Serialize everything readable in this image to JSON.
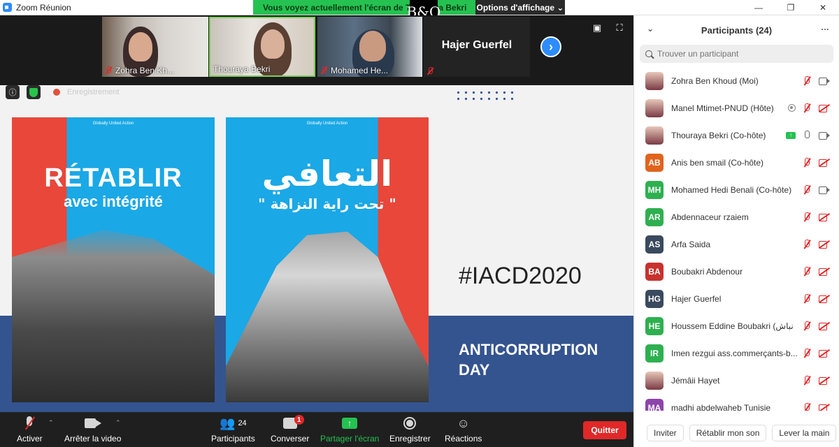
{
  "window": {
    "title": "Zoom Réunion"
  },
  "share_banner": {
    "text": "Vous voyez actuellement l'écran de Thouraya Bekri",
    "options_label": "Options d'affichage ⌄",
    "logo_text": "B&O"
  },
  "video_tiles": [
    {
      "name": "Zohra Ben Kh...",
      "muted": true
    },
    {
      "name": "Thouraya Bekri",
      "muted": false,
      "active_speaker": true
    },
    {
      "name": "Mohamed He...",
      "muted": true
    },
    {
      "name": "Hajer Guerfel",
      "muted": true,
      "video_off": true
    }
  ],
  "shared_content": {
    "recording_label": "Enregistrement",
    "poster1": {
      "logos": "Globally United Action",
      "line1": "RÉTABLIR",
      "line2": "avec intégrité"
    },
    "poster2": {
      "logos": "Globally United Action",
      "line1": "التعافي",
      "line2": "\" تحت راية النزاهة \""
    },
    "hashtag": "#IACD2020",
    "anticorruption": "ANTICORRUPTION DAY"
  },
  "toolbar": {
    "mute_label": "Activer",
    "video_label": "Arrêter la video",
    "participants_label": "Participants",
    "participants_count": "24",
    "chat_label": "Converser",
    "chat_badge": "1",
    "share_label": "Partager l'écran",
    "record_label": "Enregistrer",
    "reactions_label": "Réactions",
    "quit_label": "Quitter"
  },
  "panel": {
    "title": "Participants (24)",
    "search_placeholder": "Trouver un participant",
    "participants": [
      {
        "initials": "",
        "name": "Zohra Ben Khoud (Moi)",
        "color": "#8a3c4c",
        "photo": true
      },
      {
        "initials": "",
        "name": "Manel Mtimet-PNUD (Hôte)",
        "color": "#c8b8a8",
        "photo": true
      },
      {
        "initials": "",
        "name": "Thouraya Bekri (Co-hôte)",
        "color": "#7a3a45",
        "photo": true
      },
      {
        "initials": "AB",
        "name": "Anis ben smail (Co-hôte)",
        "color": "#e0641e"
      },
      {
        "initials": "MH",
        "name": "Mohamed Hedi Benali (Co-hôte)",
        "color": "#2eb050"
      },
      {
        "initials": "AR",
        "name": "Abdennaceur rzaiem",
        "color": "#2eb050"
      },
      {
        "initials": "AS",
        "name": "Arfa Saida",
        "color": "#3a4a5e"
      },
      {
        "initials": "BA",
        "name": "Boubakri Abdenour",
        "color": "#c8322e"
      },
      {
        "initials": "HG",
        "name": "Hajer Guerfel",
        "color": "#3a4a5e"
      },
      {
        "initials": "HE",
        "name": "Houssem Eddine Boubakri (نباش",
        "color": "#2eb050"
      },
      {
        "initials": "IR",
        "name": "Imen rezgui ass.commerçants-b...",
        "color": "#2eb050"
      },
      {
        "initials": "",
        "name": "Jémâii Hayet",
        "color": "#c8322e",
        "photo": true
      },
      {
        "initials": "MA",
        "name": "madhi abdelwaheb Tunisie",
        "color": "#8e44ad"
      }
    ],
    "footer": {
      "invite": "Inviter",
      "unmute": "Rétablir mon son",
      "lower_hand": "Lever la main"
    }
  }
}
